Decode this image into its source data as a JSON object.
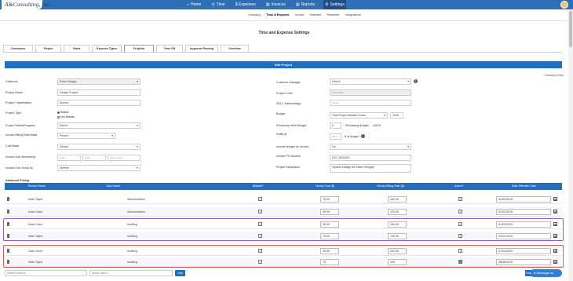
{
  "app": {
    "logo_text": "A&Consulting, Inc."
  },
  "topnav": [
    {
      "label": "Home",
      "icon": "home-icon"
    },
    {
      "label": "Time",
      "icon": "clock-icon"
    },
    {
      "label": "$ Expenses",
      "icon": "dollar-icon"
    },
    {
      "label": "Invoices",
      "icon": "document-icon"
    },
    {
      "label": "Reports",
      "icon": "chart-icon"
    },
    {
      "label": "Settings",
      "icon": "gear-icon"
    }
  ],
  "subnav": [
    "Company",
    "Time & Expense",
    "Invoice",
    "Estimate",
    "Reminder",
    "Integrations"
  ],
  "page_title": "Time and Expense Settings",
  "tabs": [
    "Customers",
    "People",
    "Tasks",
    "Expense Types",
    "Projects",
    "Time Off",
    "Approval Routing",
    "Overtime"
  ],
  "banner": "Edit Project",
  "mandatory": "* mandatory fields",
  "form_left": {
    "customer": {
      "label": "Customer",
      "value": "Ecker Design"
    },
    "project_name": {
      "label": "Project Name",
      "value": "Design Project"
    },
    "project_classification": {
      "label": "Project Classification",
      "value": "Anchor"
    },
    "project_type": {
      "label": "Project Type",
      "option1": "Billable",
      "option2": "Non Billable"
    },
    "project_status": {
      "label": "Project Status/Progress",
      "value": "Select"
    },
    "billing_rate_basis": {
      "label": "Invoice Billing Rate Basis",
      "value": "Person"
    },
    "cost_basis": {
      "label": "Cost Basis",
      "value": "Person"
    },
    "auto_numbering": {
      "label": "Invoice Auto Numbering",
      "prefix": "prefix",
      "suffix": "suffix",
      "auto_number": "auto number"
    },
    "line_group": {
      "label": "Invoice Line Group by",
      "value": "Weekly"
    }
  },
  "form_right": {
    "customer_manager": {
      "label": "Customer Manager",
      "value": "Select"
    },
    "project_code": {
      "label": "Project Code",
      "value": "RAT2RNZL"
    },
    "sdlc": {
      "label": "SDLC Methodology",
      "value": "Hybrid"
    },
    "budget": {
      "label": "Budget",
      "value": "Total Project Billable Hours",
      "amount": "2000"
    },
    "previously_used": {
      "label": "Previously Used Budget",
      "value": "0",
      "remaining_label": "Remaining Budget",
      "remaining_value": ": 15010"
    },
    "notify": {
      "label": "Notify at",
      "value": "100.0",
      "suffix": "% of budget"
    },
    "include_budget": {
      "label": "Include Budget on Invoice",
      "value": "No"
    },
    "po_number": {
      "label": "Invoice PO Number",
      "value": "EDC-8203401"
    },
    "description": {
      "label": "Project Description",
      "value": "System Design for Ecker Designs"
    }
  },
  "advanced_pricing": {
    "title": "Advanced Pricing",
    "columns": [
      "Person Name",
      "Task Name",
      "Billable?",
      "Hourly Cost ($)",
      "Hourly Billing Rate ($)",
      "Active?",
      "Rate Effective Date"
    ],
    "rows": [
      {
        "person": "Mark Taylor",
        "task": "Administration",
        "cost": "75.00",
        "rate": "100.00",
        "date": "01/01/2019"
      },
      {
        "person": "Dave Grant",
        "task": "Administration",
        "cost": "90.00",
        "rate": "120.00",
        "date": "01/01/2019"
      },
      {
        "person": "Dave Grant",
        "task": "Auditing",
        "cost": "90.00",
        "rate": "150.00",
        "date": "01/01/2019"
      },
      {
        "person": "Mark Taylor",
        "task": "Auditing",
        "cost": "75.00",
        "rate": "125.00",
        "date": "01/01/2019"
      },
      {
        "person": "Dave Grant",
        "task": "Auditing",
        "cost": "90.00",
        "rate": "200.00",
        "date": "07/01/2019"
      },
      {
        "person": "Mark Taylor",
        "task": "Auditing",
        "cost": "75",
        "rate": "125",
        "date": "08/08/2019"
      }
    ]
  },
  "bottom": {
    "person_placeholder": "Select Person ▾",
    "task_placeholder": "Select Task ▾",
    "add_label": "Add",
    "help_label": "Help",
    "message_label": "Message us"
  }
}
